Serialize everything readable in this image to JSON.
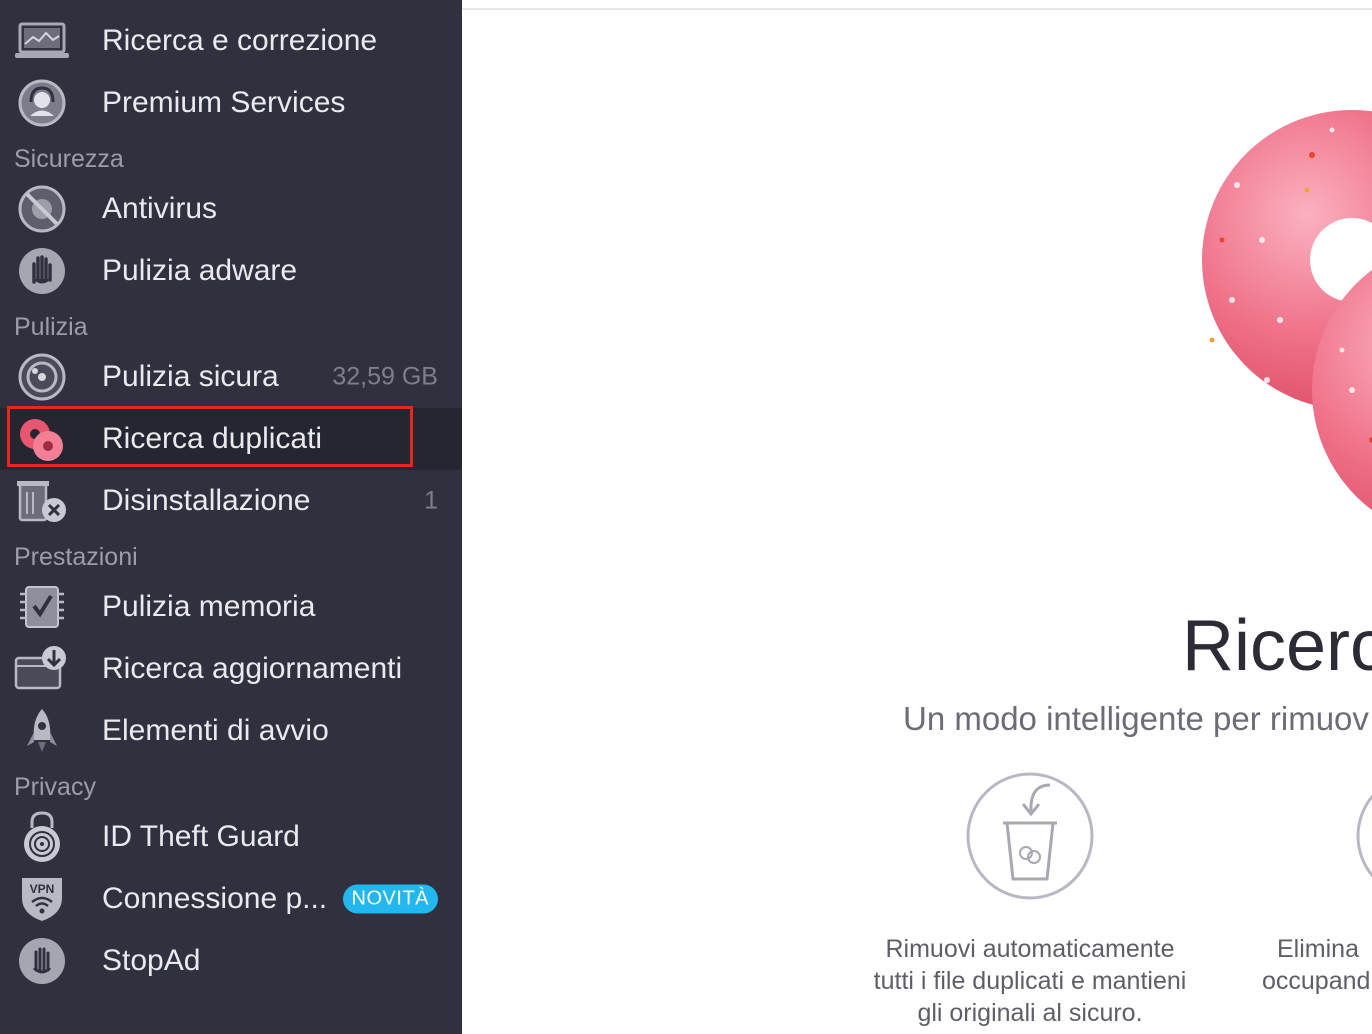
{
  "sidebar": {
    "items": [
      {
        "label": "Ricerca e correzione",
        "icon": "laptop-chart-icon"
      },
      {
        "label": "Premium Services",
        "icon": "headset-support-icon"
      },
      {
        "label": "Antivirus",
        "icon": "virus-blocked-icon"
      },
      {
        "label": "Pulizia adware",
        "icon": "hand-stop-icon"
      },
      {
        "label": "Pulizia sicura",
        "icon": "disk-cleanup-icon",
        "meta": "32,59 GB"
      },
      {
        "label": "Ricerca duplicati",
        "icon": "duplicate-donuts-icon",
        "active": true
      },
      {
        "label": "Disinstallazione",
        "icon": "trash-uninstall-icon",
        "meta": "1"
      },
      {
        "label": "Pulizia memoria",
        "icon": "memory-chip-icon"
      },
      {
        "label": "Ricerca aggiornamenti",
        "icon": "update-download-icon"
      },
      {
        "label": "Elementi di avvio",
        "icon": "rocket-icon"
      },
      {
        "label": "ID Theft Guard",
        "icon": "fingerprint-lock-icon"
      },
      {
        "label": "Connessione p...",
        "icon": "vpn-shield-icon",
        "badge": "NOVITÀ"
      },
      {
        "label": "StopAd",
        "icon": "stop-hand-icon"
      }
    ],
    "sections": [
      "Sicurezza",
      "Pulizia",
      "Prestazioni",
      "Privacy"
    ]
  },
  "main": {
    "title": "Ricerca",
    "subtitle": "Un modo intelligente per rimuov",
    "features": [
      {
        "icon": "trash-cup-arrow-icon",
        "lines": [
          "Rimuovi automaticamente",
          "tutti i file duplicati e mantieni",
          "gli originali al sicuro."
        ]
      },
      {
        "icon": "feature-two-icon",
        "lines": [
          "Elimina",
          "occupand"
        ]
      }
    ]
  },
  "colors": {
    "sidebar_bg": "#30303f",
    "active_bg": "#262633",
    "highlight": "#e5281c",
    "badge": "#22b7ee",
    "donut": "#ee6f86"
  }
}
